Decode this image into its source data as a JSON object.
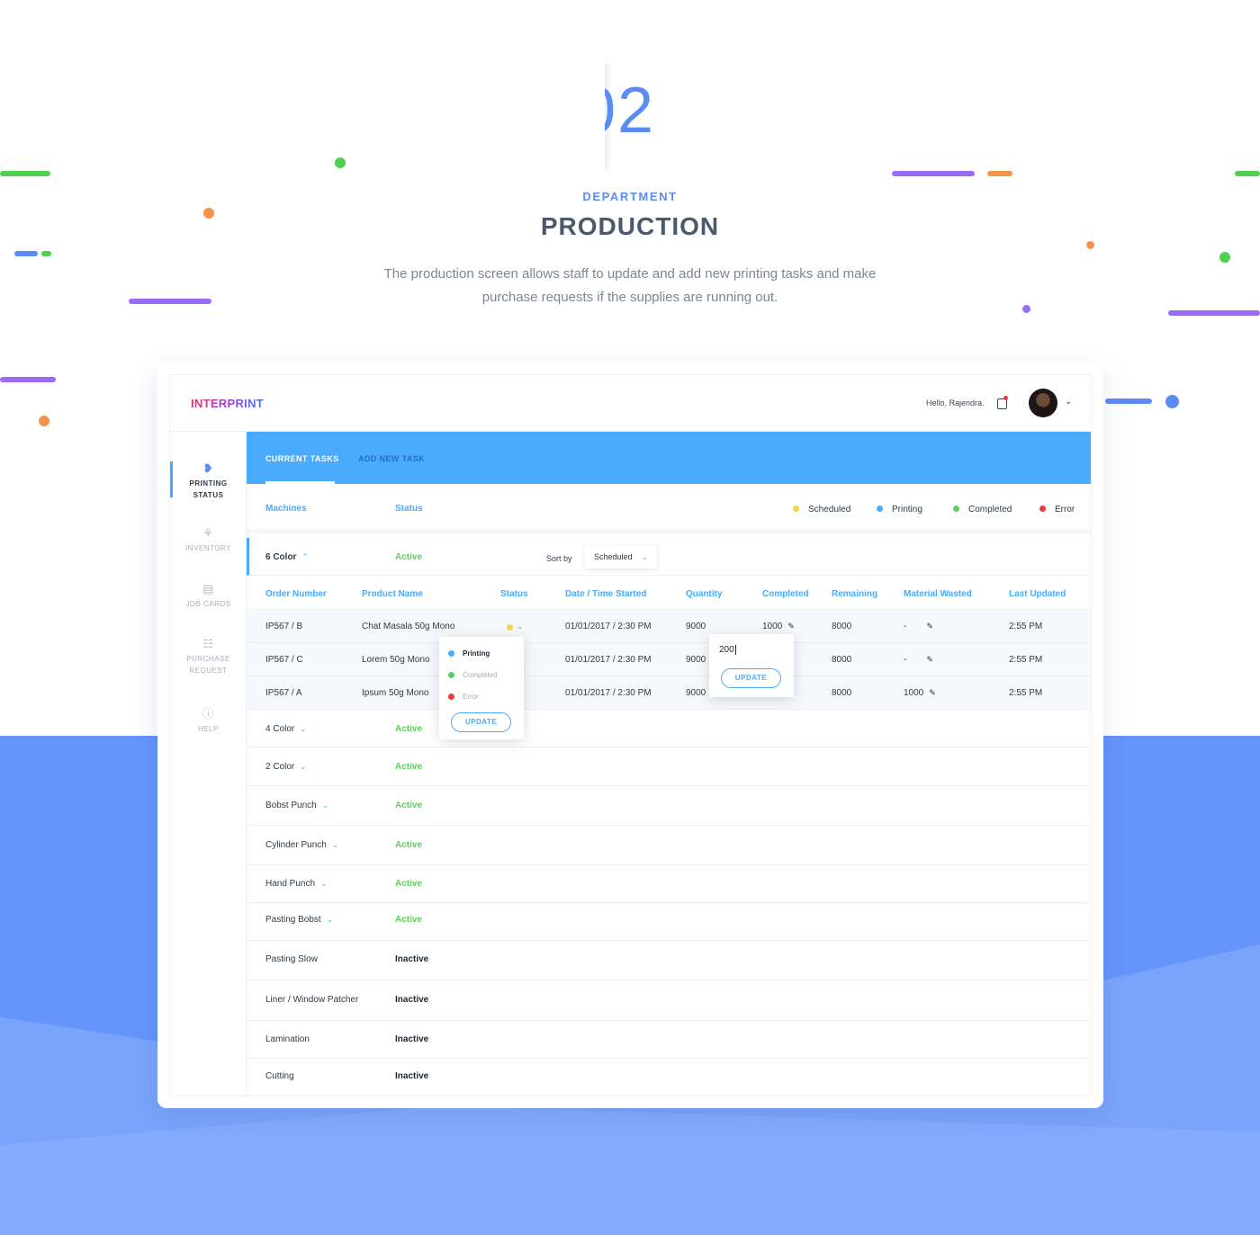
{
  "hero": {
    "number": "02",
    "department": "DEPARTMENT",
    "title": "PRODUCTION",
    "description": "The production screen allows staff to update and add new printing tasks and make purchase requests if the supplies are running out."
  },
  "app": {
    "logo": "INTERPRINT",
    "greeting": "Hello, Rajendra.",
    "sidebar": [
      {
        "label_1": "PRINTING",
        "label_2": "STATUS",
        "icon": "printer-icon"
      },
      {
        "label_1": "INVENTORY",
        "icon": "forklift-icon"
      },
      {
        "label_1": "JOB CARDS",
        "icon": "document-icon"
      },
      {
        "label_1": "PURCHASE",
        "label_2": "REQUEST",
        "icon": "cart-icon"
      },
      {
        "label_1": "HELP",
        "icon": "help-icon"
      }
    ],
    "tabs": {
      "current": "CURRENT TASKS",
      "add_new": "ADD NEW TASK"
    },
    "filters": {
      "machines": "Machines",
      "status": "Status"
    },
    "legend": [
      {
        "label": "Scheduled",
        "color": "#f7d54a"
      },
      {
        "label": "Printing",
        "color": "#4aaafc"
      },
      {
        "label": "Completed",
        "color": "#5bd05a"
      },
      {
        "label": "Error",
        "color": "#ef3b3b"
      }
    ],
    "expanded_machine": {
      "name": "6 Color",
      "status": "Active",
      "sort_by_label": "Sort by",
      "sort_value": "Scheduled"
    },
    "columns": [
      "Order Number",
      "Product Name",
      "Status",
      "Date / Time Started",
      "Quantity",
      "Completed",
      "Remaining",
      "Material Wasted",
      "Last Updated"
    ],
    "orders": [
      {
        "order": "IP567 / B",
        "product": "Chat Masala 50g Mono",
        "date": "01/01/2017 / 2:30 PM",
        "quantity": "9000",
        "completed": "1000",
        "remaining": "8000",
        "wasted": "-",
        "updated": "2:55 PM"
      },
      {
        "order": "IP567 / C",
        "product": "Lorem 50g Mono",
        "date": "01/01/2017 / 2:30 PM",
        "quantity": "9000",
        "completed": "",
        "remaining": "8000",
        "wasted": "-",
        "updated": "2:55 PM"
      },
      {
        "order": "IP567 / A",
        "product": "Ipsum 50g Mono",
        "date": "01/01/2017 / 2:30 PM",
        "quantity": "9000",
        "completed": "",
        "remaining": "8000",
        "wasted": "1000",
        "updated": "2:55 PM"
      }
    ],
    "status_popup": {
      "options": [
        "Printing",
        "Completed",
        "Error"
      ],
      "selected": "Printing",
      "button": "UPDATE"
    },
    "completed_popup": {
      "value": "200",
      "button": "UPDATE"
    },
    "machines": [
      {
        "name": "4 Color",
        "status": "Active"
      },
      {
        "name": "2 Color",
        "status": "Active"
      },
      {
        "name": "Bobst Punch",
        "status": "Active"
      },
      {
        "name": "Cylinder Punch",
        "status": "Active"
      },
      {
        "name": "Hand Punch",
        "status": "Active"
      },
      {
        "name": "Pasting Bobst",
        "status": "Active"
      },
      {
        "name": "Pasting Slow",
        "status": "Inactive"
      },
      {
        "name": "Liner / Window Patcher",
        "status": "Inactive"
      },
      {
        "name": "Lamination",
        "status": "Inactive"
      },
      {
        "name": "Cutting",
        "status": "Inactive"
      }
    ]
  }
}
